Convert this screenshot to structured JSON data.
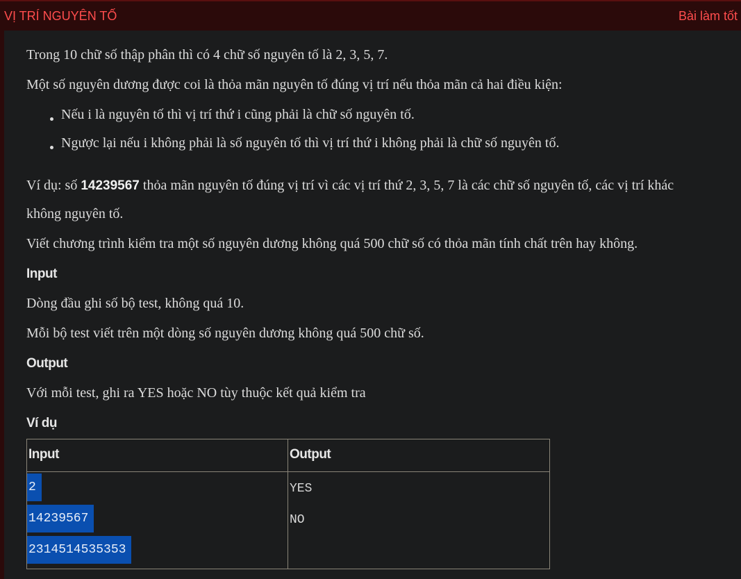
{
  "header": {
    "title": "VỊ TRÍ NGUYÊN TỐ",
    "status": "Bài làm tốt"
  },
  "body": {
    "line1": "Trong 10 chữ số thập phân thì có 4 chữ số nguyên tố là 2, 3, 5, 7.",
    "line2": "Một số nguyên dương được coi là thỏa mãn nguyên tố đúng vị trí nếu thỏa mãn cả hai điều kiện:",
    "bullets": [
      "Nếu i là nguyên tố thì vị trí thứ i cũng phải là chữ số nguyên tố.",
      "Ngược lại nếu i không phải là số nguyên tố thì vị trí thứ i không phải là chữ số nguyên tố."
    ],
    "example_prefix": "Ví dụ: số ",
    "example_number": "14239567",
    "example_suffix": " thỏa mãn nguyên tố đúng vị trí vì các vị trí thứ 2, 3, 5, 7 là các chữ số nguyên tố, các vị trí khác",
    "example_cont": "không nguyên tố.",
    "task": "Viết chương trình kiểm tra một số nguyên dương không quá 500 chữ số có thỏa mãn tính chất trên hay không.",
    "input_heading": "Input",
    "input_line1": "Dòng đầu ghi số bộ test, không quá 10.",
    "input_line2": "Mỗi bộ test viết trên một dòng số nguyên dương không quá 500 chữ số.",
    "output_heading": "Output",
    "output_line1": "Với mỗi test, ghi ra YES hoặc NO tùy thuộc kết quả kiểm tra",
    "example_heading": "Ví dụ"
  },
  "example_table": {
    "headers": [
      "Input",
      "Output"
    ],
    "input_lines": [
      "2",
      "14239567",
      "2314514535353"
    ],
    "output_lines": [
      "YES",
      "NO"
    ]
  }
}
